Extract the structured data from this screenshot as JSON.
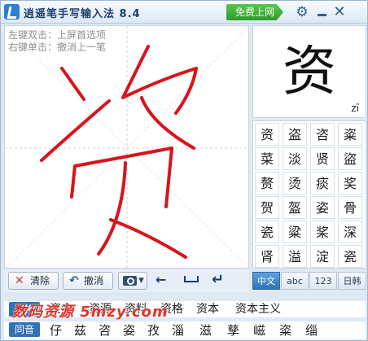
{
  "titlebar": {
    "title": "逍遥笔手写输入法 8.4",
    "free_button": "免费上网",
    "icons": [
      "gear-icon",
      "minimize-icon",
      "close-icon"
    ]
  },
  "pad": {
    "hint_left_double": "左键双击：上屏首选项",
    "hint_right_single": "右键单击：撤消上一笔",
    "stroke_color": "#d8141c"
  },
  "toolbar": {
    "clear_label": "清除",
    "undo_label": "撤消"
  },
  "preview": {
    "char": "资",
    "pinyin": "zī"
  },
  "candidates": [
    "资",
    "盗",
    "咨",
    "粢",
    "菜",
    "淡",
    "贤",
    "盜",
    "赘",
    "烫",
    "痰",
    "奖",
    "贺",
    "盔",
    "姿",
    "骨",
    "瓷",
    "粱",
    "桨",
    "深",
    "肾",
    "溢",
    "淀",
    "瓷"
  ],
  "mode_tabs": [
    "中文",
    "abc",
    "123",
    "日韩"
  ],
  "associated_words": {
    "label": "资格",
    "words": [
      "资金",
      "资源",
      "资料",
      "资格",
      "资本",
      "资本主义"
    ]
  },
  "homophones": {
    "label": "同音",
    "chars": [
      "仔",
      "兹",
      "咨",
      "姿",
      "孜",
      "淄",
      "滋",
      "孳",
      "嵫",
      "粢",
      "缁"
    ]
  },
  "watermark": "数码资源 5mzy.com",
  "colors": {
    "accent_blue": "#2f72b8",
    "free_button_green": "#3bb034",
    "stroke_red": "#d8141c"
  }
}
